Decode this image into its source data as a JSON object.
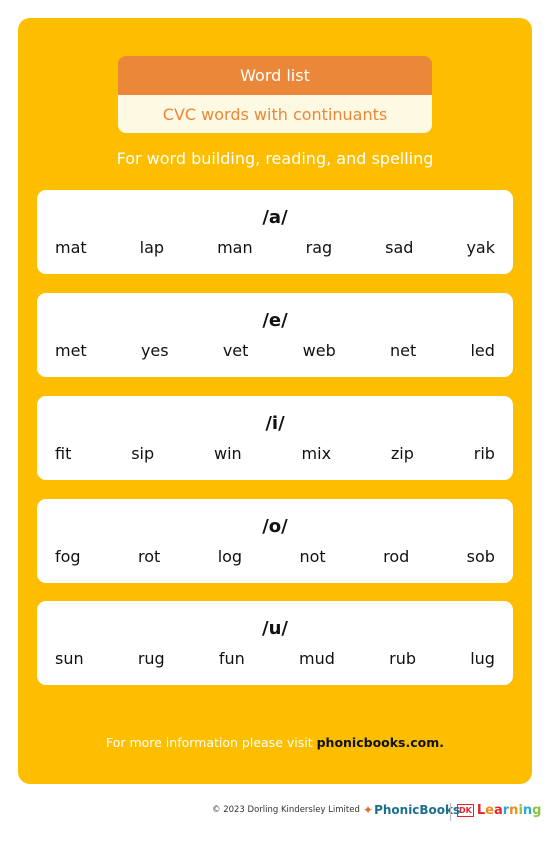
{
  "header": {
    "title": "Word list",
    "subtitle": "CVC words with continuants",
    "tagline": "For word building, reading, and spelling"
  },
  "colors": {
    "background": "#FDBE00",
    "title_bar": "#EB8738",
    "subtitle_bar": "#FEF9E3",
    "card": "#FFFFFF"
  },
  "cards": [
    {
      "sound": "/a/",
      "words": [
        "mat",
        "lap",
        "man",
        "rag",
        "sad",
        "yak"
      ]
    },
    {
      "sound": "/e/",
      "words": [
        "met",
        "yes",
        "vet",
        "web",
        "net",
        "led"
      ]
    },
    {
      "sound": "/i/",
      "words": [
        "fit",
        "sip",
        "win",
        "mix",
        "zip",
        "rib"
      ]
    },
    {
      "sound": "/o/",
      "words": [
        "fog",
        "rot",
        "log",
        "not",
        "rod",
        "sob"
      ]
    },
    {
      "sound": "/u/",
      "words": [
        "sun",
        "rug",
        "fun",
        "mud",
        "rub",
        "lug"
      ]
    }
  ],
  "footer_info": {
    "prefix": "For more information please visit ",
    "link": "phonicbooks.com."
  },
  "footer": {
    "copyright": "© 2023 Dorling Kindersley Limited",
    "phonicbooks_logo": "PhonicBooks",
    "phonicbooks_icon": "kite-icon",
    "dk_badge": "DK",
    "dk_learning": [
      "L",
      "e",
      "a",
      "r",
      "n",
      "i",
      "n",
      "g"
    ]
  }
}
